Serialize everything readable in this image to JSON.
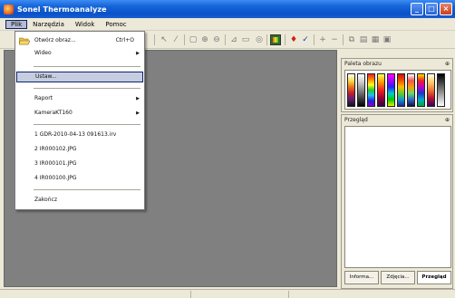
{
  "window": {
    "title": "Sonel Thermoanalyze",
    "controls": [
      "_",
      "□",
      "×"
    ]
  },
  "menubar": {
    "items": [
      {
        "label": "Plik",
        "active": true
      },
      {
        "label": "Narzędzia",
        "active": false
      },
      {
        "label": "Widok",
        "active": false
      },
      {
        "label": "Pomoc",
        "active": false
      }
    ]
  },
  "file_menu": {
    "items": [
      {
        "label": "Otwórz obraz...",
        "shortcut": "Ctrl+O",
        "submenu": false
      },
      {
        "label": "Wideo",
        "shortcut": "",
        "submenu": true
      },
      {
        "label": "Ustaw...",
        "shortcut": "",
        "submenu": false,
        "highlight": true
      },
      {
        "label": "Raport",
        "shortcut": "",
        "submenu": true
      },
      {
        "label": "KameraKT160",
        "shortcut": "",
        "submenu": true
      },
      {
        "label": "1 GDR-2010-04-13 091613.irv",
        "shortcut": "",
        "submenu": false
      },
      {
        "label": "2 IR000102.JPG",
        "shortcut": "",
        "submenu": false
      },
      {
        "label": "3 IR000101.JPG",
        "shortcut": "",
        "submenu": false
      },
      {
        "label": "4 IR000100.JPG",
        "shortcut": "",
        "submenu": false
      },
      {
        "label": "Zakończ",
        "shortcut": "",
        "submenu": false
      }
    ]
  },
  "palette_panel": {
    "title": "Paleta obrazu",
    "pin": "⊕"
  },
  "preview_panel": {
    "title": "Przegląd",
    "pin": "⊕",
    "tabs": [
      {
        "label": "Informa...",
        "selected": false
      },
      {
        "label": "Zdjęcia...",
        "selected": false
      },
      {
        "label": "Przegląd",
        "selected": true
      }
    ]
  },
  "colors": {
    "titlebar": "#0a52c8",
    "workspace": "#808080",
    "menu_highlight": "#c7cde0"
  },
  "toolbar": {
    "icons": [
      "cursor-icon",
      "line-icon",
      "zoom-in-icon",
      "zoom-out-icon",
      "grid-icon",
      "palette-icon",
      "marker-icon",
      "plus-icon",
      "minus-icon",
      "copy-icon",
      "paste-icon",
      "print-icon"
    ]
  }
}
